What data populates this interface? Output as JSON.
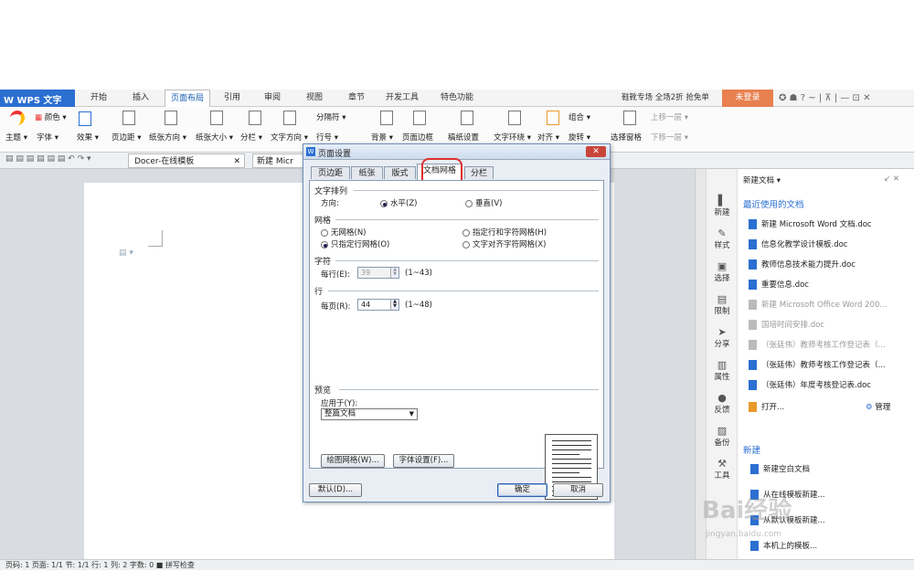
{
  "app": {
    "brand": "W WPS 文字",
    "promo": "鞋靴专场 全场2折 抢免单",
    "login": "未登录",
    "window_controls": "✪ ☗ ? ~ | ⊼ | — ⊡ ✕"
  },
  "menu_tabs": [
    {
      "label": "开始",
      "active": false
    },
    {
      "label": "插入",
      "active": false
    },
    {
      "label": "页面布局",
      "active": true
    },
    {
      "label": "引用",
      "active": false
    },
    {
      "label": "审阅",
      "active": false
    },
    {
      "label": "视图",
      "active": false
    },
    {
      "label": "章节",
      "active": false
    },
    {
      "label": "开发工具",
      "active": false
    },
    {
      "label": "特色功能",
      "active": false
    }
  ],
  "ribbon": {
    "theme": "主题 ▾",
    "color": "颜色 ▾",
    "font": "字体 ▾",
    "effect": "效果 ▾",
    "margins": "页边距 ▾",
    "orientation": "纸张方向 ▾",
    "size": "纸张大小 ▾",
    "columns": "分栏 ▾",
    "text_dir": "文字方向 ▾",
    "breaks": "分隔符 ▾",
    "line_num": "行号 ▾",
    "background": "背景 ▾",
    "border": "页面边框",
    "paper_set": "稿纸设置",
    "wrap": "文字环绕 ▾",
    "align": "对齐 ▾",
    "group": "组合 ▾",
    "rotate": "旋转 ▾",
    "selection": "选择窗格",
    "up": "上移一层 ▾",
    "down": "下移一层 ▾"
  },
  "tabs_bar": {
    "docer": "Docer-在线模板",
    "doc": "新建 Micr"
  },
  "dialog": {
    "title": "页面设置",
    "close": "✕",
    "tabs": [
      "页边距",
      "纸张",
      "版式",
      "文档网格",
      "分栏"
    ],
    "active_tab": "文档网格",
    "text_direction": {
      "section": "文字排列",
      "label": "方向:",
      "horizontal": "水平(Z)",
      "vertical": "垂直(V)"
    },
    "grid": {
      "section": "网格",
      "none": "无网格(N)",
      "lines_only": "只指定行网格(O)",
      "lines_chars": "指定行和字符网格(H)",
      "snap_chars": "文字对齐字符网格(X)"
    },
    "chars": {
      "section": "字符",
      "label": "每行(E):",
      "value": "39",
      "range": "(1~43)"
    },
    "lines": {
      "section": "行",
      "label": "每页(R):",
      "value": "44",
      "range": "(1~48)"
    },
    "preview": {
      "section": "预览",
      "apply_label": "应用于(Y):",
      "apply_value": "整篇文档"
    },
    "buttons": {
      "draw_grid": "绘图网格(W)...",
      "font_settings": "字体设置(F)...",
      "default": "默认(D)...",
      "ok": "确定",
      "cancel": "取消"
    }
  },
  "sidebar_tools": [
    "新建",
    "样式",
    "选择",
    "限制",
    "分享",
    "属性",
    "反馈",
    "备份",
    "工具"
  ],
  "taskpane": {
    "header": "新建文档 ▾",
    "recent_title": "最近使用的文档",
    "recent": [
      {
        "name": "新建 Microsoft Word 文档.doc",
        "dim": false
      },
      {
        "name": "信息化教学设计模板.doc",
        "dim": false
      },
      {
        "name": "教师信息技术能力提升.doc",
        "dim": false
      },
      {
        "name": "重要信息.doc",
        "dim": false
      },
      {
        "name": "新建 Microsoft Office Word 200...",
        "dim": true
      },
      {
        "name": "国培时间安排.doc",
        "dim": true
      },
      {
        "name": "（张廷伟）教师考核工作登记表（...",
        "dim": true
      },
      {
        "name": "（张廷伟）教师考核工作登记表（...",
        "dim": false
      },
      {
        "name": "（张廷伟）年度考核登记表.doc",
        "dim": false
      }
    ],
    "open": "打开...",
    "manage": "管理",
    "new_title": "新建",
    "new_items": [
      "新建空白文档",
      "从在线模板新建...",
      "从默认模板新建...",
      "本机上的模板..."
    ]
  },
  "watermark": {
    "main": "Bai经验",
    "sub": "jingyan.baidu.com"
  },
  "status": "页码: 1   页面: 1/1   节: 1/1   行: 1   列: 2   字数: 0   ■ 拼写检查"
}
